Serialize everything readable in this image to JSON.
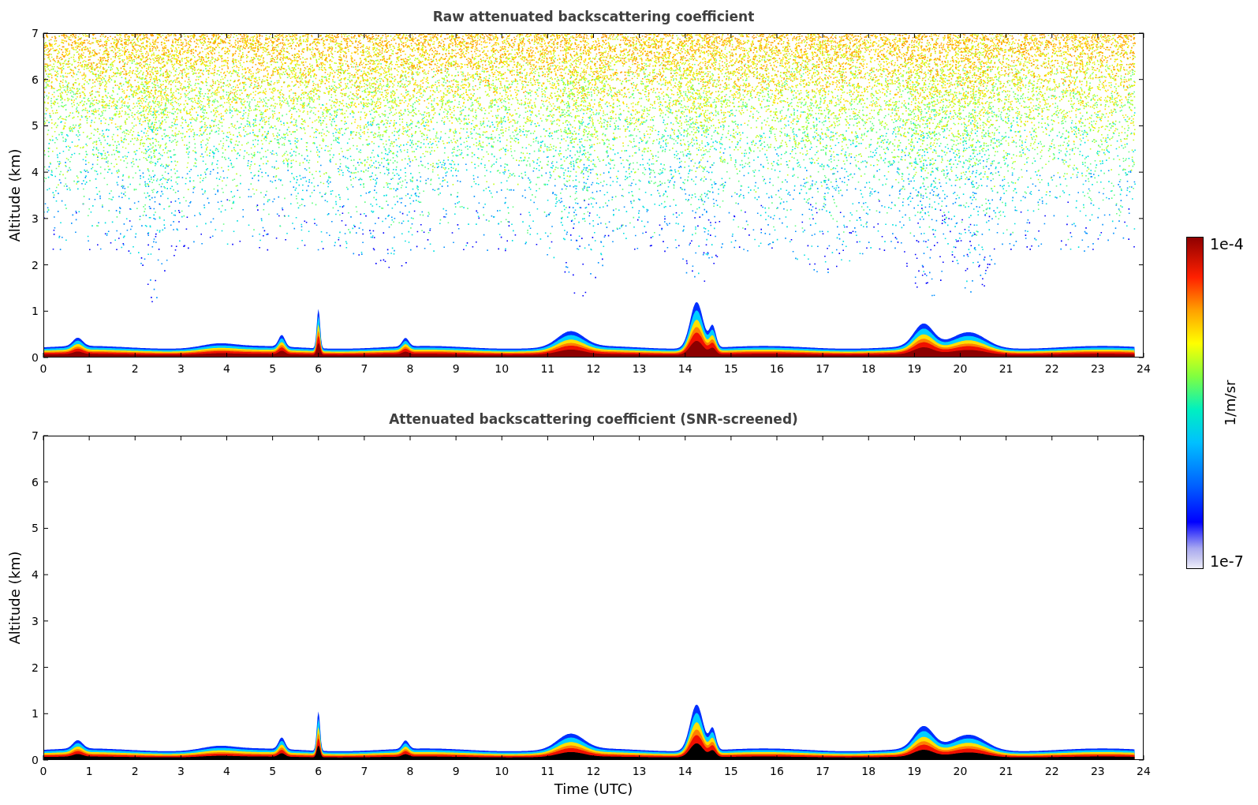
{
  "panels": [
    {
      "kind": "raw",
      "title": "Raw attenuated backscattering coefficient",
      "ylabel": "Altitude (km)",
      "yticks": [
        "7",
        "6",
        "5",
        "4",
        "3",
        "2",
        "1",
        "0"
      ],
      "xticks": [
        "0",
        "1",
        "2",
        "3",
        "4",
        "5",
        "6",
        "7",
        "8",
        "9",
        "10",
        "11",
        "12",
        "13",
        "14",
        "15",
        "16",
        "17",
        "18",
        "19",
        "20",
        "21",
        "22",
        "23",
        "24"
      ]
    },
    {
      "kind": "screened",
      "title": "Attenuated backscattering coefficient (SNR-screened)",
      "ylabel": "Altitude (km)",
      "yticks": [
        "7",
        "6",
        "5",
        "4",
        "3",
        "2",
        "1",
        "0"
      ],
      "xticks": [
        "0",
        "1",
        "2",
        "3",
        "4",
        "5",
        "6",
        "7",
        "8",
        "9",
        "10",
        "11",
        "12",
        "13",
        "14",
        "15",
        "16",
        "17",
        "18",
        "19",
        "20",
        "21",
        "22",
        "23",
        "24"
      ],
      "xlabel": "Time (UTC)"
    }
  ],
  "colorbar": {
    "top_label": "1e-4",
    "bottom_label": "1e-7",
    "unit_label": "1/m/sr"
  }
}
